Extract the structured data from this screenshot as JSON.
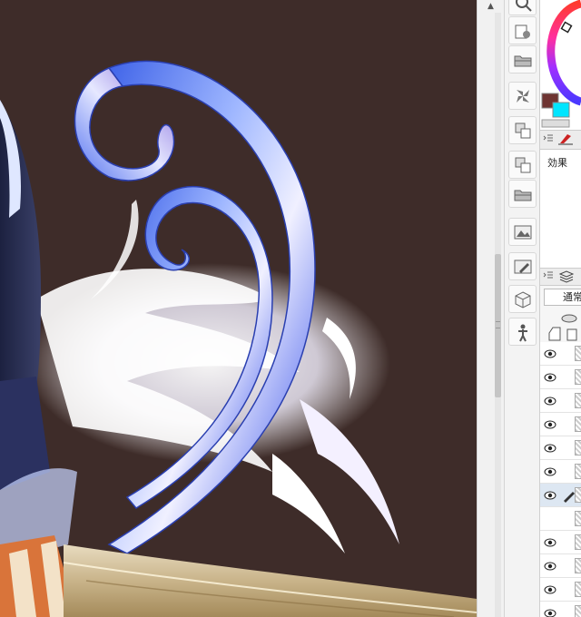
{
  "canvas": {
    "background_color": "#3e2c29",
    "content": "illustration"
  },
  "scrollbar": {
    "up_arrow": "▲"
  },
  "command_bar": {
    "buttons": [
      {
        "icon": "search-icon"
      },
      {
        "icon": "new-canvas-icon"
      },
      {
        "icon": "open-folder-icon"
      },
      {
        "icon": "pinwheel-icon"
      },
      {
        "icon": "layer-material-icon"
      },
      {
        "icon": "layer-material-icon"
      },
      {
        "icon": "open-folder-icon"
      },
      {
        "icon": "image-material-icon"
      },
      {
        "icon": "brush-material-icon"
      },
      {
        "icon": "3d-cube-icon"
      },
      {
        "icon": "3d-figure-icon"
      }
    ]
  },
  "color_panel": {
    "main_color": "#6e3432",
    "sub_color": "#00e5ff"
  },
  "effect_panel": {
    "title": "効果"
  },
  "layer_panel": {
    "blend_mode": "通常",
    "rows": [
      {
        "visible": true,
        "selected": false
      },
      {
        "visible": true,
        "selected": false
      },
      {
        "visible": true,
        "selected": false
      },
      {
        "visible": true,
        "selected": false
      },
      {
        "visible": true,
        "selected": false
      },
      {
        "visible": true,
        "selected": false
      },
      {
        "visible": true,
        "selected": true
      },
      {
        "visible": false,
        "selected": false
      },
      {
        "visible": true,
        "selected": false
      },
      {
        "visible": true,
        "selected": false
      },
      {
        "visible": true,
        "selected": false
      },
      {
        "visible": true,
        "selected": false
      }
    ]
  }
}
